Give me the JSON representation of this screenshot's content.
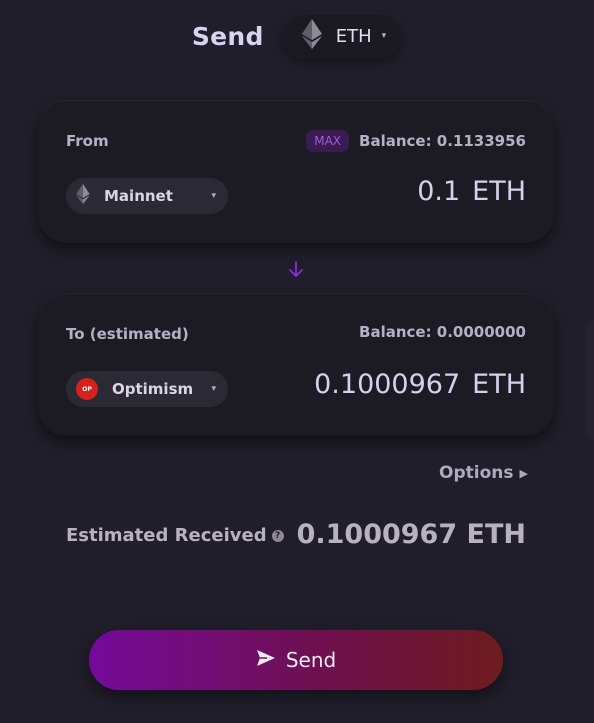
{
  "header": {
    "title": "Send",
    "token_symbol": "ETH",
    "token_icon": "ethereum-icon"
  },
  "from_card": {
    "label": "From",
    "max_label": "MAX",
    "balance": "Balance: 0.1133956",
    "network": "Mainnet",
    "network_icon": "ethereum-icon",
    "amount": "0.1",
    "amount_unit": "ETH"
  },
  "direction_icon": "arrow-down-icon",
  "to_card": {
    "label": "To (estimated)",
    "balance": "Balance: 0.0000000",
    "network": "Optimism",
    "network_badge": "OP",
    "network_icon": "optimism-icon",
    "amount": "0.1000967",
    "amount_unit": "ETH"
  },
  "options": {
    "label": "Options"
  },
  "estimate": {
    "label": "Estimated Received",
    "value": "0.1000967 ETH"
  },
  "send_button": {
    "label": "Send",
    "icon": "send-icon"
  },
  "colors": {
    "background": "#201e2a",
    "card": "#1c1b24",
    "accent": "#8a2be2",
    "max_badge_bg": "#3a1b52",
    "max_badge_text": "#a35be0",
    "optimism_red": "#d6221c",
    "button_gradient_start": "#740a9a",
    "button_gradient_end": "#6e1c1e"
  }
}
